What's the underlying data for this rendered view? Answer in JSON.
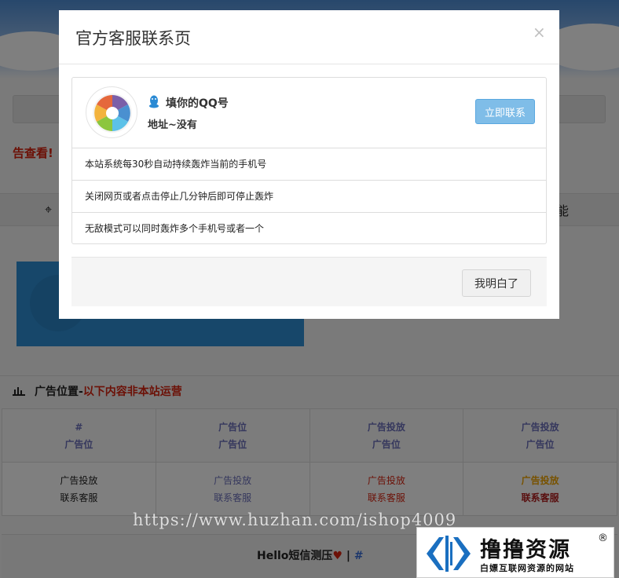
{
  "background": {
    "warning_text": "告查看!",
    "tab_right_text": "能",
    "ad_section": {
      "title": "广告位置-",
      "title_red": "以下内容非本站运营",
      "rows": [
        [
          {
            "line1": "#",
            "line2": "广告位"
          },
          {
            "line1": "广告位",
            "line2": "广告位"
          },
          {
            "line1": "广告投放",
            "line2": "广告位"
          },
          {
            "line1": "广告投放",
            "line2": "广告位"
          }
        ],
        [
          {
            "line1": "广告投放",
            "line2": "联系客服"
          },
          {
            "line1": "广告投放",
            "line2": "联系客服"
          },
          {
            "line1": "广告投放",
            "line2": "联系客服"
          },
          {
            "line1": "广告投放",
            "line2": "联系客服"
          }
        ]
      ]
    },
    "footer": {
      "text": "Hello短信测压",
      "separator": " | ",
      "link": "#"
    }
  },
  "modal": {
    "title": "官方客服联系页",
    "close_glyph": "×",
    "profile": {
      "name": "填你的QQ号",
      "address": "地址~没有",
      "contact_button": "立即联系"
    },
    "notices": [
      "本站系统每30秒自动持续轰炸当前的手机号",
      "关闭网页或者点击停止几分钟后即可停止轰炸",
      "无敌模式可以同时轰炸多个手机号或者一个"
    ],
    "ok_button": "我明白了"
  },
  "overlay_marks": {
    "watermark": "https://www.huzhan.com/ishop4009",
    "logo_title": "撸撸资源",
    "logo_sub": "白嫖互联网资源的网站",
    "logo_reg": "®"
  },
  "colors": {
    "accent_blue": "#7fbde8",
    "warning_red": "#d9230f",
    "ad_purple": "#6b6fbb",
    "ad_orange": "#f0a500"
  }
}
